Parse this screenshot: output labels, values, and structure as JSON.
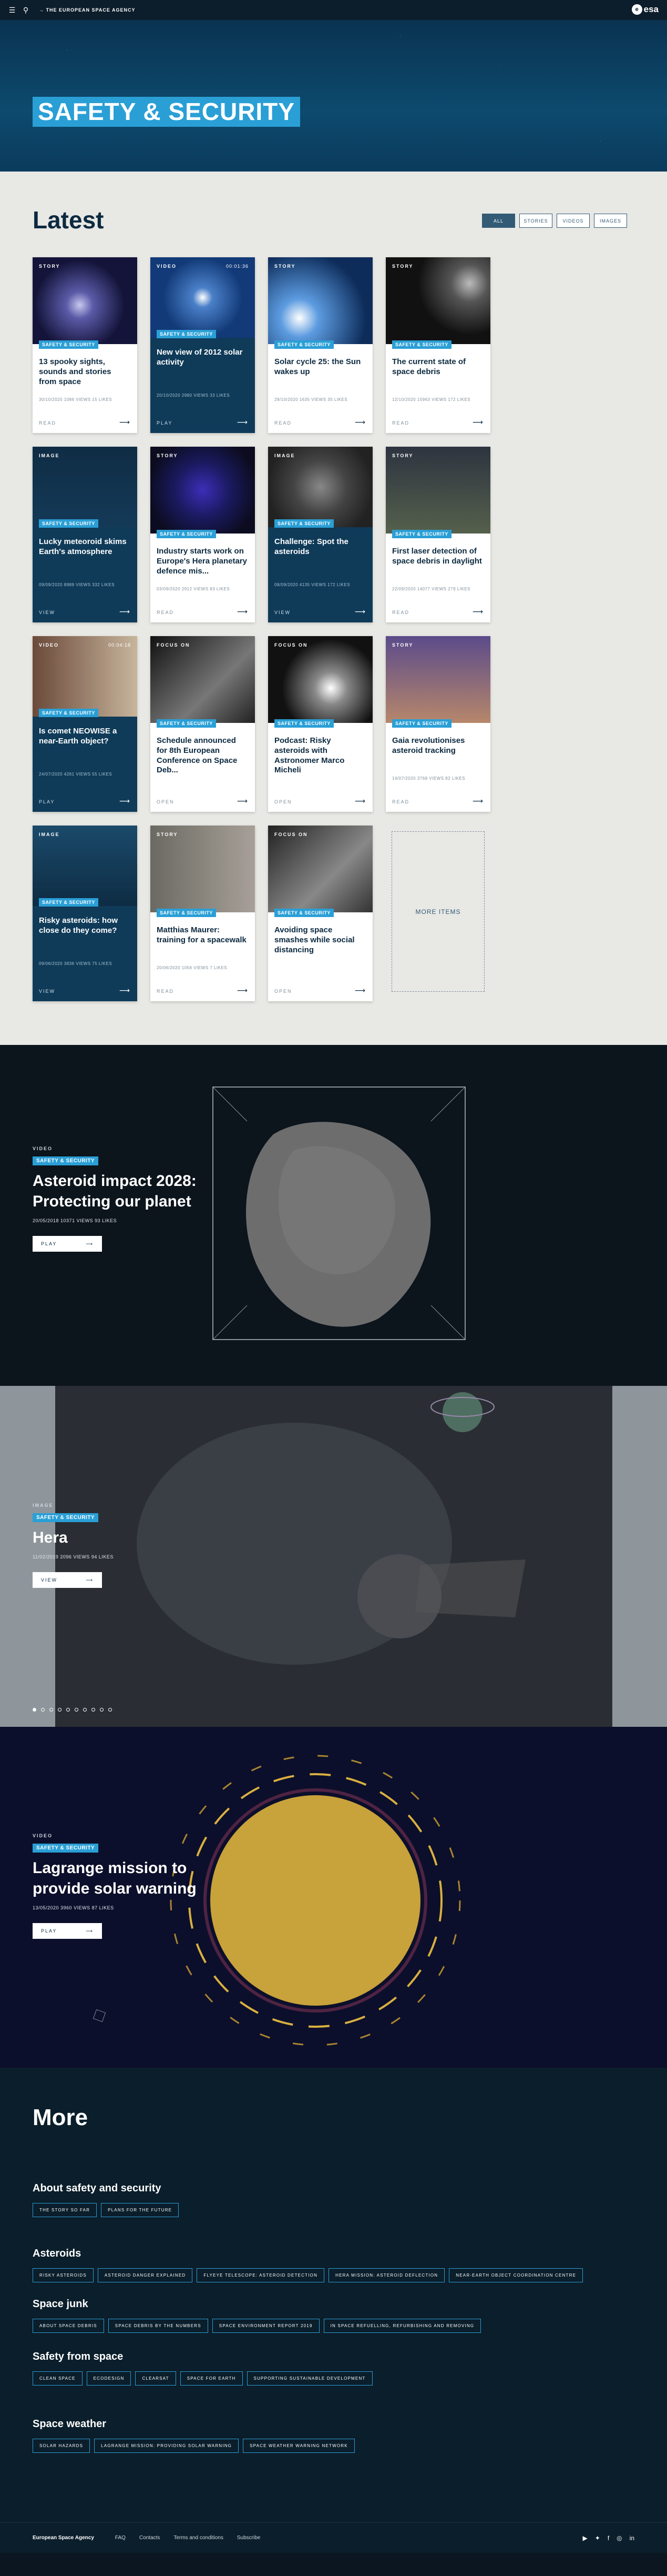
{
  "topbar": {
    "menu_icon": "hamburger-icon",
    "search_icon": "search-icon",
    "agency": "→ THE EUROPEAN SPACE AGENCY",
    "logo_text": "esa"
  },
  "hero": {
    "title": "SAFETY & SECURITY"
  },
  "latest": {
    "heading": "Latest",
    "filters": [
      "ALL",
      "STORIES",
      "VIDEOS",
      "IMAGES"
    ],
    "active_filter": "ALL",
    "cards": [
      {
        "type": "STORY",
        "dark": false,
        "tag": "SAFETY & SECURITY",
        "title": "13 spooky sights, sounds and stories from space",
        "meta": "30/10/2020   1086 VIEWS   15 LIKES",
        "action": "READ"
      },
      {
        "type": "VIDEO",
        "dur": "00:01:36",
        "dark": true,
        "tag": "SAFETY & SECURITY",
        "title": "New view of 2012 solar activity",
        "meta": "20/10/2020   2980 VIEWS   33 LIKES",
        "action": "PLAY"
      },
      {
        "type": "STORY",
        "dark": false,
        "tag": "SAFETY & SECURITY",
        "title": "Solar cycle 25: the Sun wakes up",
        "meta": "28/10/2020   1635 VIEWS   35 LIKES",
        "action": "READ"
      },
      {
        "type": "STORY",
        "dark": false,
        "tag": "SAFETY & SECURITY",
        "title": "The current state of space debris",
        "meta": "12/10/2020   15963 VIEWS   172 LIKES",
        "action": "READ"
      },
      {
        "type": "IMAGE",
        "dark": true,
        "tag": "SAFETY & SECURITY",
        "title": "Lucky meteoroid skims Earth's atmosphere",
        "meta": "09/09/2020   8989 VIEWS   332 LIKES",
        "action": "VIEW"
      },
      {
        "type": "STORY",
        "dark": false,
        "tag": "SAFETY & SECURITY",
        "title": "Industry starts work on Europe's Hera planetary defence mis...",
        "meta": "03/09/2020   2912 VIEWS   83 LIKES",
        "action": "READ"
      },
      {
        "type": "IMAGE",
        "dark": true,
        "tag": "SAFETY & SECURITY",
        "title": "Challenge: Spot the asteroids",
        "meta": "08/09/2020   4135 VIEWS   172 LIKES",
        "action": "VIEW"
      },
      {
        "type": "STORY",
        "dark": false,
        "tag": "SAFETY & SECURITY",
        "title": "First laser detection of space debris in daylight",
        "meta": "22/09/2020   14077 VIEWS   279 LIKES",
        "action": "READ"
      },
      {
        "type": "VIDEO",
        "dur": "00:04:18",
        "dark": true,
        "tag": "SAFETY & SECURITY",
        "title": "Is comet NEOWISE a near-Earth object?",
        "meta": "24/07/2020   4261 VIEWS   55 LIKES",
        "action": "PLAY"
      },
      {
        "type": "FOCUS ON",
        "dark": false,
        "tag": "SAFETY & SECURITY",
        "title": "Schedule announced for 8th European Conference on Space Deb...",
        "meta": "",
        "action": "OPEN"
      },
      {
        "type": "FOCUS ON",
        "dark": false,
        "tag": "SAFETY & SECURITY",
        "title": "Podcast: Risky asteroids with Astronomer Marco Micheli",
        "meta": "",
        "action": "OPEN"
      },
      {
        "type": "STORY",
        "dark": false,
        "tag": "SAFETY & SECURITY",
        "title": "Gaia revolutionises asteroid tracking",
        "meta": "14/07/2020   3768 VIEWS   82 LIKES",
        "action": "READ"
      },
      {
        "type": "IMAGE",
        "dark": true,
        "tag": "SAFETY & SECURITY",
        "title": "Risky asteroids: how close do they come?",
        "meta": "09/06/2020   3836 VIEWS   75 LIKES",
        "action": "VIEW"
      },
      {
        "type": "STORY",
        "dark": false,
        "tag": "SAFETY & SECURITY",
        "title": "Matthias Maurer: training for a spacewalk",
        "meta": "20/06/2020   1056 VIEWS   7 LIKES",
        "action": "READ"
      },
      {
        "type": "FOCUS ON",
        "dark": false,
        "tag": "SAFETY & SECURITY",
        "title": "Avoiding space smashes while social distancing",
        "meta": "",
        "action": "OPEN"
      }
    ],
    "more_items": "MORE ITEMS"
  },
  "features": [
    {
      "type": "VIDEO",
      "tag": "SAFETY & SECURITY",
      "title": "Asteroid impact 2028: Protecting our planet",
      "meta": "20/05/2018   10371 VIEWS   93 LIKES",
      "button": "PLAY"
    },
    {
      "type": "IMAGE",
      "tag": "SAFETY & SECURITY",
      "title": "Hera",
      "meta": "11/02/2019   2096 VIEWS   94 LIKES",
      "button": "VIEW"
    },
    {
      "type": "VIDEO",
      "tag": "SAFETY & SECURITY",
      "title": "Lagrange mission to provide solar warning",
      "meta": "13/05/2020   3960 VIEWS   87 LIKES",
      "button": "PLAY"
    }
  ],
  "more": {
    "heading": "More",
    "groups": [
      {
        "title": "About safety and security",
        "chips": [
          "THE STORY SO FAR",
          "PLANS FOR THE FUTURE"
        ]
      },
      {
        "title": "Asteroids",
        "chips": [
          "RISKY ASTEROIDS",
          "ASTEROID DANGER EXPLAINED",
          "FLYEYE TELESCOPE: ASTEROID DETECTION",
          "HERA MISSION: ASTEROID DEFLECTION",
          "NEAR-EARTH OBJECT COORDINATION CENTRE"
        ]
      },
      {
        "title": "Space junk",
        "chips": [
          "ABOUT SPACE DEBRIS",
          "SPACE DEBRIS BY THE NUMBERS",
          "SPACE ENVIRONMENT REPORT 2019",
          "IN SPACE REFUELLING, REFURBISHING AND REMOVING"
        ]
      },
      {
        "title": "Safety from space",
        "chips": [
          "CLEAN SPACE",
          "ECODESIGN",
          "CLEARSAT",
          "SPACE FOR EARTH",
          "SUPPORTING SUSTAINABLE DEVELOPMENT"
        ]
      },
      {
        "title": "Space weather",
        "chips": [
          "SOLAR HAZARDS",
          "LAGRANGE MISSION: PROVIDING SOLAR WARNING",
          "SPACE WEATHER WARNING NETWORK"
        ]
      }
    ]
  },
  "footer": {
    "org": "European Space Agency",
    "links": [
      "FAQ",
      "Contacts",
      "Terms and conditions",
      "Subscribe"
    ],
    "social": [
      "youtube-icon",
      "twitter-icon",
      "facebook-icon",
      "instagram-icon",
      "linkedin-icon"
    ]
  }
}
